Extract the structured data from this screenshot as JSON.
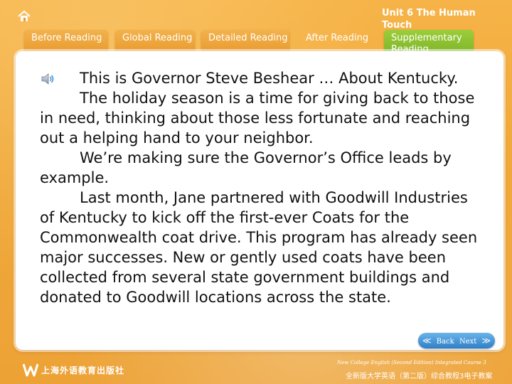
{
  "header": {
    "unit_title": "Unit 6 The Human Touch",
    "home_icon": "home-icon"
  },
  "tabs": [
    {
      "label": "Before Reading"
    },
    {
      "label": "Global Reading"
    },
    {
      "label": "Detailed Reading"
    },
    {
      "label": "After Reading"
    },
    {
      "label": "Supplementary Reading"
    }
  ],
  "content": {
    "speaker_icon": "speaker-icon",
    "paragraphs": [
      "This is Governor Steve Beshear … About Kentucky.",
      "The holiday season is a time for giving back to those in need, thinking about those less fortunate and reaching out a helping hand to your neighbor.",
      "We’re making sure the Governor’s Office leads by example.",
      "Last month, Jane partnered with Goodwill Industries of Kentucky to kick off the first-ever Coats for the Commonwealth coat drive. This program has already seen major successes. New or gently used coats have been collected from several state government buildings and donated to Goodwill locations across the state."
    ]
  },
  "nav": {
    "back_label": "Back",
    "next_label": "Next"
  },
  "footer": {
    "publisher_name": "上海外语教育出版社",
    "course_en": "New College English (Second Edition) Integrated Course 3",
    "course_cn": "全新版大学英语（第二版）综合教程3电子教案"
  },
  "colors": {
    "background": "#f0a93b",
    "tab_active": "#8cc232",
    "nav_button": "#3a8fd6"
  }
}
